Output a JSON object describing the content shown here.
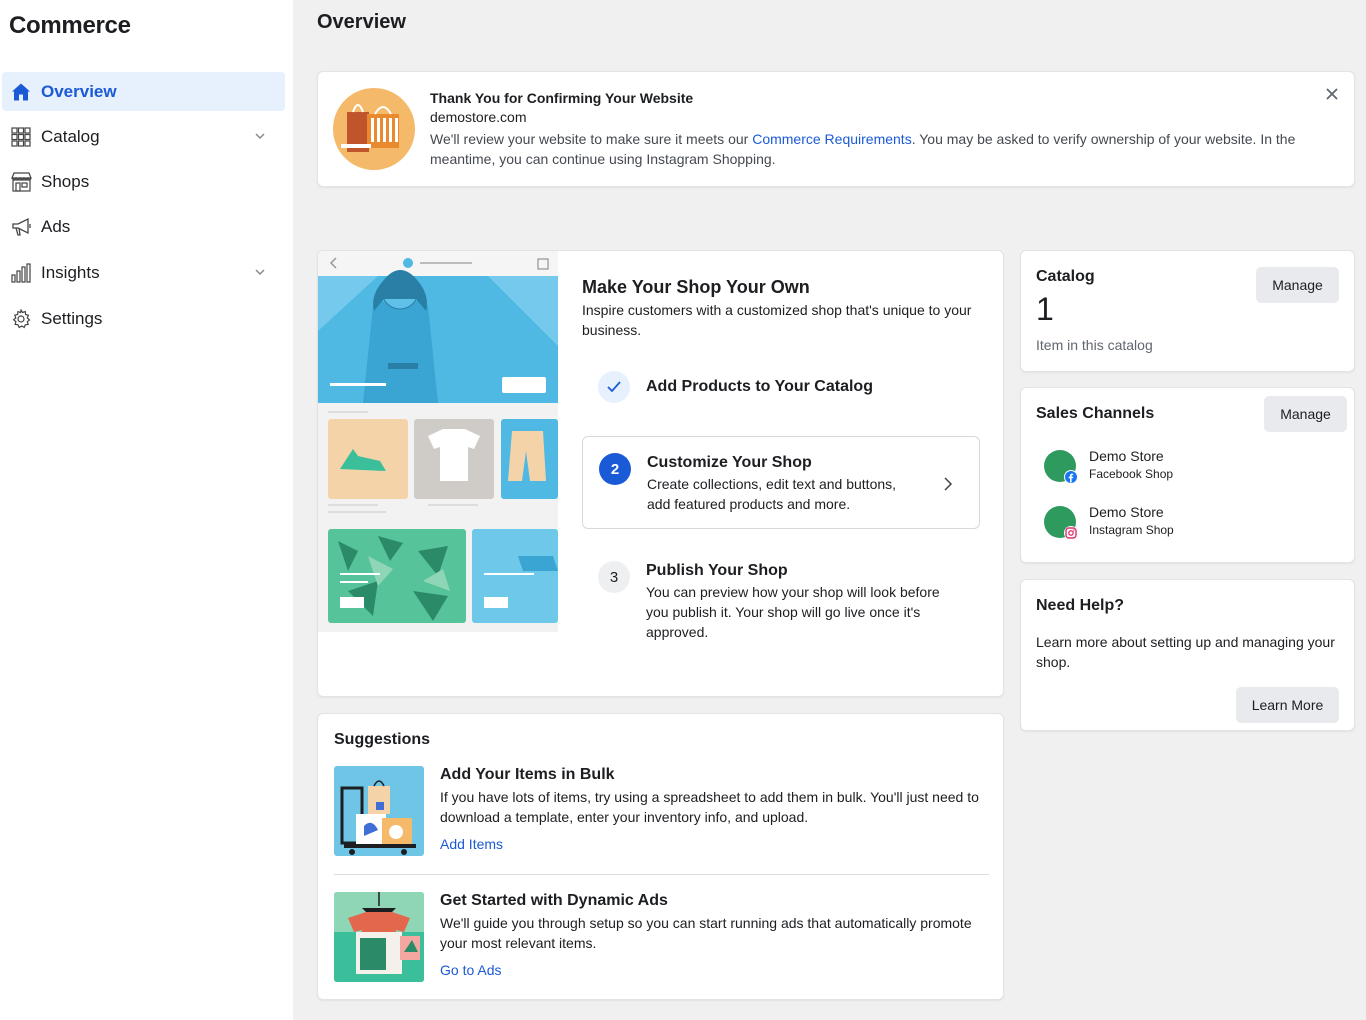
{
  "app": {
    "title": "Commerce"
  },
  "nav": [
    {
      "label": "Overview",
      "icon": "home-icon",
      "active": true
    },
    {
      "label": "Catalog",
      "icon": "grid-icon",
      "expandable": true
    },
    {
      "label": "Shops",
      "icon": "storefront-icon"
    },
    {
      "label": "Ads",
      "icon": "megaphone-icon"
    },
    {
      "label": "Insights",
      "icon": "bar-chart-icon",
      "expandable": true
    },
    {
      "label": "Settings",
      "icon": "gear-icon"
    }
  ],
  "page": {
    "title": "Overview"
  },
  "banner": {
    "title": "Thank You for Confirming Your Website",
    "domain": "demostore.com",
    "body_prefix": "We'll review your website to make sure it meets our ",
    "body_link": "Commerce Requirements",
    "body_suffix": ". You may be asked to verify ownership of your website. In the meantime, you can continue using Instagram Shopping."
  },
  "shop_setup": {
    "heading": "Make Your Shop Your Own",
    "subheading": "Inspire customers with a customized shop that's unique to your business.",
    "steps": [
      {
        "number": "",
        "status": "done",
        "title": "Add Products to Your Catalog",
        "description": ""
      },
      {
        "number": "2",
        "status": "current",
        "title": "Customize Your Shop",
        "description": "Create collections, edit text and buttons, add featured products and more."
      },
      {
        "number": "3",
        "status": "pending",
        "title": "Publish Your Shop",
        "description": "You can preview how your shop will look before you publish it. Your shop will go live once it's approved."
      }
    ]
  },
  "suggestions": {
    "heading": "Suggestions",
    "items": [
      {
        "title": "Add Your Items in Bulk",
        "description": "If you have lots of items, try using a spreadsheet to add them in bulk. You'll just need to download a template, enter your inventory info, and upload.",
        "link": "Add Items"
      },
      {
        "title": "Get Started with Dynamic Ads",
        "description": "We'll guide you through setup so you can start running ads that automatically promote your most relevant items.",
        "link": "Go to Ads"
      }
    ]
  },
  "catalog": {
    "title": "Catalog",
    "manage_label": "Manage",
    "count": "1",
    "count_label": "Item in this catalog"
  },
  "sales_channels": {
    "title": "Sales Channels",
    "manage_label": "Manage",
    "channels": [
      {
        "name": "Demo Store",
        "type": "Facebook Shop",
        "badge": "facebook-icon"
      },
      {
        "name": "Demo Store",
        "type": "Instagram Shop",
        "badge": "instagram-icon"
      }
    ]
  },
  "help": {
    "title": "Need Help?",
    "text": "Learn more about setting up and managing your shop.",
    "button": "Learn More"
  },
  "colors": {
    "accent": "#1b5ad6",
    "active_bg": "#e7f0fd",
    "channel_avatar": "#2e9a5d",
    "illus_blue": "#4fb9e3"
  }
}
